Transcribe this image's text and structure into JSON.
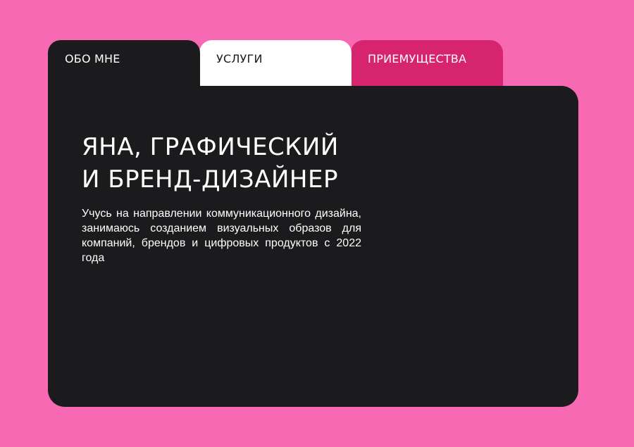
{
  "colors": {
    "background": "#f76ab3",
    "panel": "#1b1a1c",
    "tab_about_bg": "#1b1a1c",
    "tab_services_bg": "#ffffff",
    "tab_advantages_bg": "#d6246e",
    "text_light": "#ffffff",
    "text_dark": "#1b1a1c"
  },
  "tabs": [
    {
      "label": "ОБО МНЕ"
    },
    {
      "label": "УСЛУГИ"
    },
    {
      "label": "ПРИЕМУЩЕСТВА"
    }
  ],
  "hero": {
    "title_line_1": "ЯНА, ГРАФИЧЕСКИЙ",
    "title_line_2": "И БРЕНД-ДИЗАЙНЕР",
    "description": "Учусь на направлении коммуникационного дизайна, занимаюсь созданием визуальных образов для компаний, брендов и цифровых продуктов с 2022 года"
  }
}
